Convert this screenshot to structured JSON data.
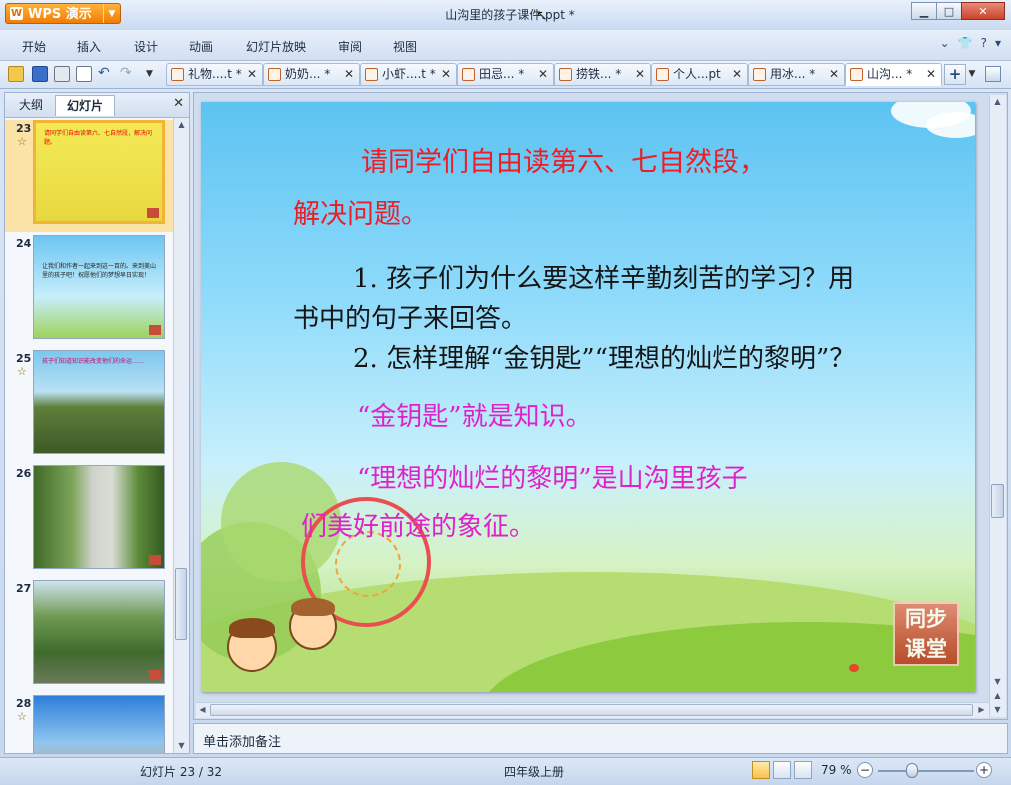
{
  "app": {
    "logo_label": "WPS 演示",
    "logo_letter": "W",
    "window_title": "山沟里的孩子课件.ppt *"
  },
  "menu": {
    "items": [
      "开始",
      "插入",
      "设计",
      "动画",
      "幻灯片放映",
      "审阅",
      "视图"
    ]
  },
  "tabs": [
    {
      "label": "礼物....t *"
    },
    {
      "label": "奶奶... *"
    },
    {
      "label": "小虾....t *"
    },
    {
      "label": "田忌... *"
    },
    {
      "label": "捞铁... *"
    },
    {
      "label": "个人...pt"
    },
    {
      "label": "用冰... *"
    },
    {
      "label": "山沟... *"
    }
  ],
  "left_panel": {
    "tab_outline": "大纲",
    "tab_slides": "幻灯片",
    "thumbnails": [
      {
        "number": "23",
        "text": "请同学们自由读第六、七自然段，解决问题。"
      },
      {
        "number": "24",
        "text": "让我们和作者一起来到这一百的。来到美山里的孩子吧！祝愿他们的梦想早日实现！"
      },
      {
        "number": "25",
        "text": "孩子们知道知识能改变他们的命运……"
      },
      {
        "number": "26",
        "text": ""
      },
      {
        "number": "27",
        "text": ""
      },
      {
        "number": "28",
        "text": ""
      }
    ]
  },
  "slide": {
    "title_line1": "请同学们自由读第六、七自然段，",
    "title_line2": "解决问题。",
    "question1_line1": "1. 孩子们为什么要这样辛勤刻苦的学习？用",
    "question1_line2": "书中的句子来回答。",
    "question2": "2. 怎样理解“金钥匙”“理想的灿烂的黎明”？",
    "answer1": "“金钥匙”就是知识。",
    "answer2_line1": "“理想的灿烂的黎明”是山沟里孩子",
    "answer2_line2": "们美好前途的象征。",
    "stamp_line1": "同步",
    "stamp_line2": "课堂"
  },
  "notes": {
    "placeholder": "单击添加备注"
  },
  "status": {
    "slide_info": "幻灯片 23 / 32",
    "theme": "四年级上册",
    "zoom": "79 %"
  },
  "colors": {
    "title_red": "#ee1c25",
    "answer_magenta": "#e020c8",
    "selected_thumb": "#f4b237",
    "logo_orange": "#f07d06"
  }
}
